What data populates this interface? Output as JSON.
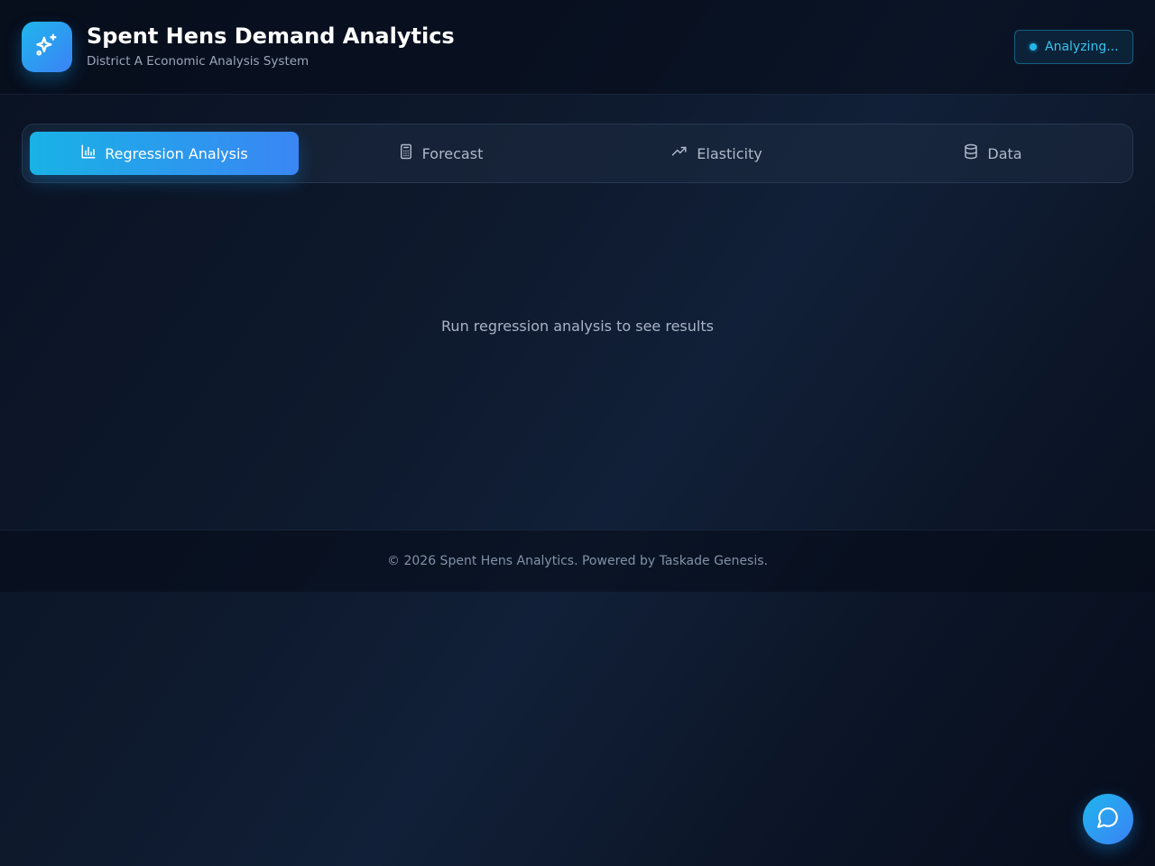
{
  "header": {
    "logo_icon": "sparkles-icon",
    "title": "Spent Hens Demand Analytics",
    "subtitle": "District A Economic Analysis System",
    "status_label": "Analyzing...",
    "status_color": "#22b7e8"
  },
  "tabs": [
    {
      "label": "Regression Analysis",
      "icon": "bar-chart-icon",
      "active": true
    },
    {
      "label": "Forecast",
      "icon": "calculator-icon",
      "active": false
    },
    {
      "label": "Elasticity",
      "icon": "trending-up-icon",
      "active": false
    },
    {
      "label": "Data",
      "icon": "database-icon",
      "active": false
    }
  ],
  "main": {
    "empty_message": "Run regression analysis to see results"
  },
  "footer": {
    "text": "© 2026 Spent Hens Analytics. Powered by Taskade Genesis."
  },
  "chat": {
    "icon": "message-circle-icon"
  },
  "colors": {
    "accent_start": "#1fb6ec",
    "accent_end": "#3b82f6",
    "background": "#0c1628"
  }
}
